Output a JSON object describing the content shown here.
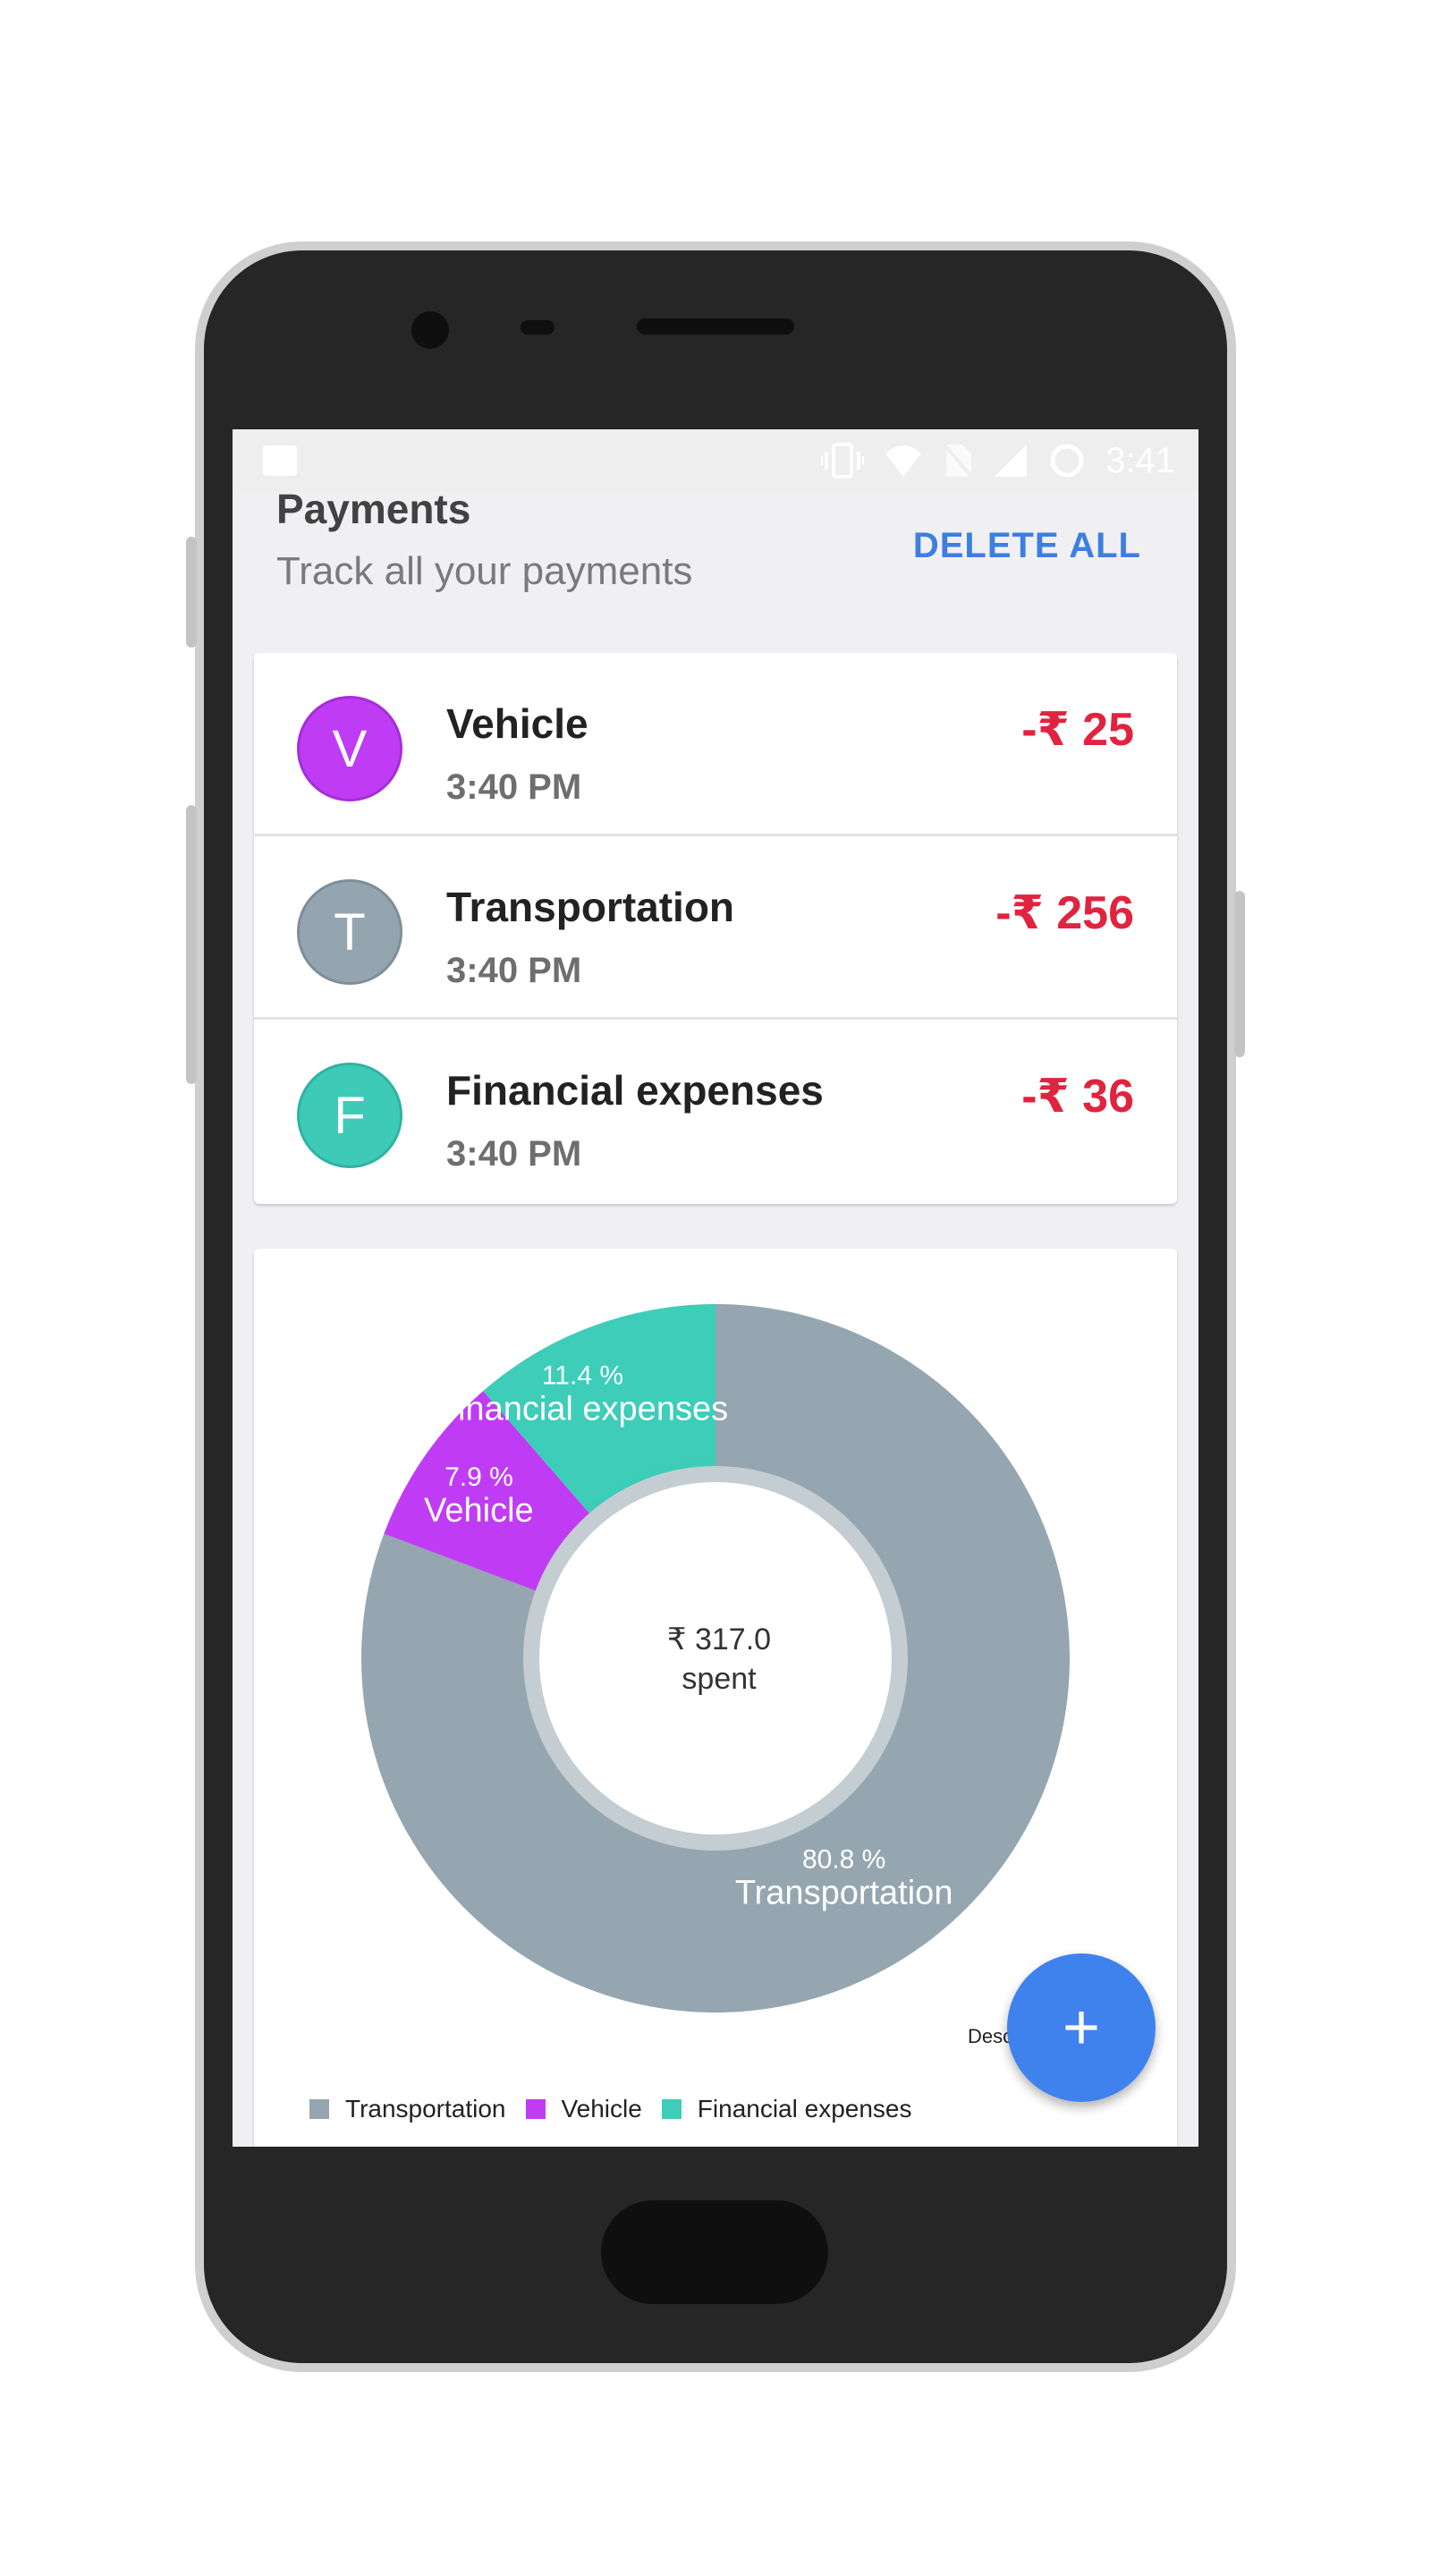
{
  "status_bar": {
    "time": "3:41"
  },
  "header": {
    "title": "Payments",
    "subtitle": "Track all your payments",
    "action": "DELETE ALL"
  },
  "payments": [
    {
      "initial": "V",
      "name": "Vehicle",
      "time": "3:40 PM",
      "amount": "-₹ 25",
      "color": "#bf3cf4"
    },
    {
      "initial": "T",
      "name": "Transportation",
      "time": "3:40 PM",
      "amount": "-₹ 256",
      "color": "#95a5b0"
    },
    {
      "initial": "F",
      "name": "Financial expenses",
      "time": "3:40 PM",
      "amount": "-₹ 36",
      "color": "#3dcbb8"
    }
  ],
  "chart_data": {
    "type": "pie",
    "center_text": [
      "₹ 317.0",
      "spent"
    ],
    "slices": [
      {
        "name": "Transportation",
        "value": 80.8,
        "label": "80.8 %",
        "color": "#95a6b0"
      },
      {
        "name": "Vehicle",
        "value": 7.9,
        "label": "7.9 %",
        "color": "#bf3cf4"
      },
      {
        "name": "Financial expenses",
        "value": 11.4,
        "label": "11.4 %",
        "color": "#3dcdb9"
      }
    ],
    "legend": [
      "Transportation",
      "Vehicle",
      "Financial expenses"
    ],
    "legend_placement": "bottom-left",
    "description": "Desc"
  },
  "fab": {
    "icon": "plus-icon",
    "label": "+"
  }
}
